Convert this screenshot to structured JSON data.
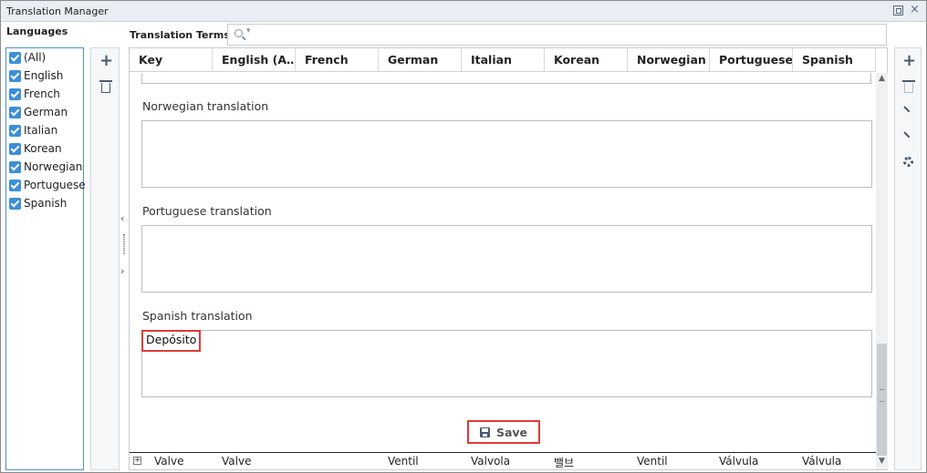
{
  "window": {
    "title": "Translation Manager"
  },
  "languages": {
    "heading": "Languages",
    "items": [
      {
        "label": "(All)",
        "checked": true
      },
      {
        "label": "English",
        "checked": true
      },
      {
        "label": "French",
        "checked": true
      },
      {
        "label": "German",
        "checked": true
      },
      {
        "label": "Italian",
        "checked": true
      },
      {
        "label": "Korean",
        "checked": true
      },
      {
        "label": "Norwegian",
        "checked": true
      },
      {
        "label": "Portuguese",
        "checked": true
      },
      {
        "label": "Spanish",
        "checked": true
      }
    ]
  },
  "terms": {
    "heading": "Translation Terms",
    "search_value": "",
    "columns": [
      "Key",
      "English (A…",
      "French",
      "German",
      "Italian",
      "Korean",
      "Norwegian",
      "Portuguese",
      "Spanish"
    ]
  },
  "editor": {
    "fields": [
      {
        "label": "Norwegian translation",
        "value": ""
      },
      {
        "label": "Portuguese translation",
        "value": ""
      },
      {
        "label": "Spanish translation",
        "value": "Depósito"
      }
    ],
    "save_label": "Save"
  },
  "row": {
    "expander": "+",
    "cells": [
      "Valve",
      "Valve",
      "",
      "Ventil",
      "Valvola",
      "밸브",
      "Ventil",
      "Válvula",
      "Válvula"
    ]
  },
  "colors": {
    "accent": "#3c8fd6",
    "highlight": "#e03a3a",
    "titlebar": "#e9eef4"
  }
}
